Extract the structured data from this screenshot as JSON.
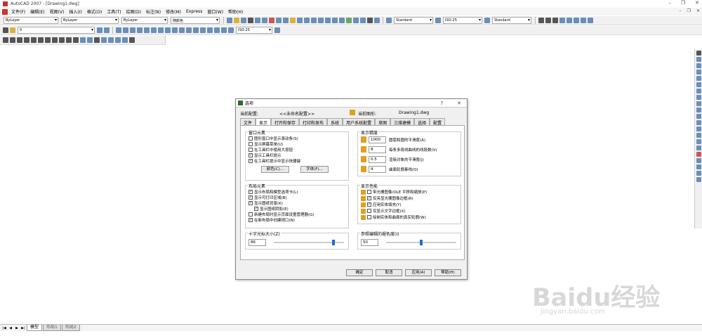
{
  "app": {
    "title": "AutoCAD 2007 - [Drawing1.dwg]"
  },
  "menu": [
    "文件(F)",
    "编辑(E)",
    "视图(V)",
    "插入(I)",
    "格式(O)",
    "工具(T)",
    "绘图(D)",
    "标注(N)",
    "修改(M)",
    "Express",
    "窗口(W)",
    "帮助(H)"
  ],
  "toolbar": {
    "text_style": "Standard",
    "dim_style": "ISO-25",
    "table_style": "Standard",
    "layer": "0",
    "color": "ByLayer",
    "linetype": "ByLayer",
    "lineweight": "ByLayer",
    "plotstyle": "随颜色",
    "dim_style2": "ISO-25"
  },
  "layout_tabs": [
    "模型",
    "布局1",
    "布局2"
  ],
  "watermark": {
    "text": "Baidu经验",
    "url": "jingyan.baidu.com"
  },
  "dialog": {
    "title": "选项",
    "help": "?",
    "current_profile_label": "当前配置:",
    "current_profile_value": "<<未命名配置>>",
    "current_drawing_label": "当前图形:",
    "current_drawing_value": "Drawing1.dwg",
    "tabs": [
      "文件",
      "显示",
      "打开和保存",
      "打印和发布",
      "系统",
      "用户系统配置",
      "草图",
      "三维建模",
      "选择",
      "配置"
    ],
    "window_elements": {
      "title": "窗口元素",
      "items": [
        {
          "label": "图形窗口中显示滚动条(S)",
          "checked": false
        },
        {
          "label": "显示屏幕菜单(U)",
          "checked": false
        },
        {
          "label": "在工具栏中使用大按钮",
          "checked": false
        },
        {
          "label": "显示工具栏提示",
          "checked": true
        },
        {
          "label": "在工具栏提示中显示快捷键",
          "checked": true
        }
      ],
      "color_button": "颜色(C)...",
      "font_button": "字体(F)..."
    },
    "layout_elements": {
      "title": "布局元素",
      "items": [
        {
          "label": "显示布局和模型选项卡(L)",
          "checked": true
        },
        {
          "label": "显示可打印区域(B)",
          "checked": true
        },
        {
          "label": "显示图纸背景(K)",
          "checked": true
        },
        {
          "label": "显示图纸阴影(E)",
          "checked": true
        },
        {
          "label": "新建布局时显示页面设置管理器(G)",
          "checked": false
        },
        {
          "label": "在新布局中创建视口(N)",
          "checked": true
        }
      ]
    },
    "display_resolution": {
      "title": "显示精度",
      "items": [
        {
          "value": "1000",
          "label": "圆弧和圆的平滑度(A)"
        },
        {
          "value": "8",
          "label": "每条多段线曲线的线段数(V)"
        },
        {
          "value": "0.5",
          "label": "渲染对象的平滑度(J)"
        },
        {
          "value": "4",
          "label": "曲面轮廓素线(O)"
        }
      ]
    },
    "display_performance": {
      "title": "显示性能",
      "items": [
        {
          "label": "带光栅图像/OLE 平移和缩放(P)",
          "checked": false
        },
        {
          "label": "仅亮显光栅图像边框(R)",
          "checked": true
        },
        {
          "label": "应用实体填充(Y)",
          "checked": true
        },
        {
          "label": "仅显示文字边框(X)",
          "checked": false
        },
        {
          "label": "绘制实体和曲面的真实轮廓(W)",
          "checked": false
        }
      ]
    },
    "crosshair": {
      "title": "十字光标大小(Z)",
      "value": "86",
      "fraction": 0.86
    },
    "reference_fade": {
      "title": "参照编辑的褪色度(I)",
      "value": "50",
      "fraction": 0.5
    },
    "buttons": {
      "ok": "确定",
      "cancel": "取消",
      "apply": "应用(A)",
      "help": "帮助(H)"
    }
  }
}
